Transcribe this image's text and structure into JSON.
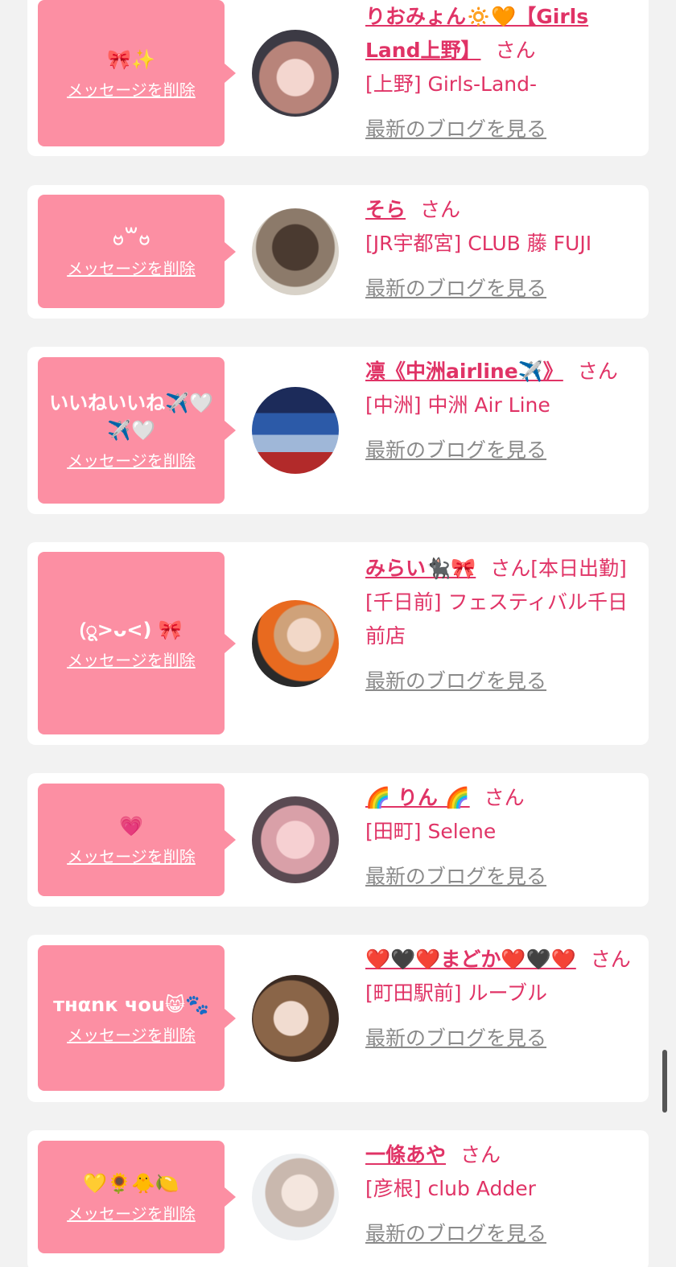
{
  "colors": {
    "bubble": "#fc8fa3",
    "name": "#e03366",
    "blog_link": "#8a8a8a",
    "card": "#ffffff",
    "background": "#f2f2f2"
  },
  "delete_label": "メッセージを削除",
  "blog_label": "最新のブログを見る",
  "san_label": "さん",
  "items": [
    {
      "message": "🎀✨",
      "name": "りおみょん🔅🧡【Girls Land上野】",
      "suffix": "",
      "shop": "[上野] Girls-Land-"
    },
    {
      "message": "ဗ꒳ဗ",
      "name": "そら",
      "suffix": "",
      "shop": "[JR宇都宮] CLUB 藤 FUJI"
    },
    {
      "message": "いいねいいね✈️🤍✈️🤍",
      "name": "凛《中洲airline✈️》",
      "suffix": "",
      "shop": "[中洲] 中洲 Air Line"
    },
    {
      "message": "(ू>ᴗ<) 🎀",
      "name": "みらい🐈‍⬛🎀",
      "suffix": "[本日出勤]",
      "shop": "[千日前] フェスティバル千日前店"
    },
    {
      "message": "💗",
      "name": "🌈 りん 🌈",
      "suffix": "",
      "shop": "[田町] Selene"
    },
    {
      "message": "тнαnк чou😸🐾",
      "name": "❤️🖤❤️まどか❤️🖤❤️",
      "suffix": "",
      "shop": "[町田駅前] ルーブル"
    },
    {
      "message": "💛🌻🐥🍋",
      "name": "一條あや",
      "suffix": "",
      "shop": "[彦根] club Adder"
    }
  ]
}
